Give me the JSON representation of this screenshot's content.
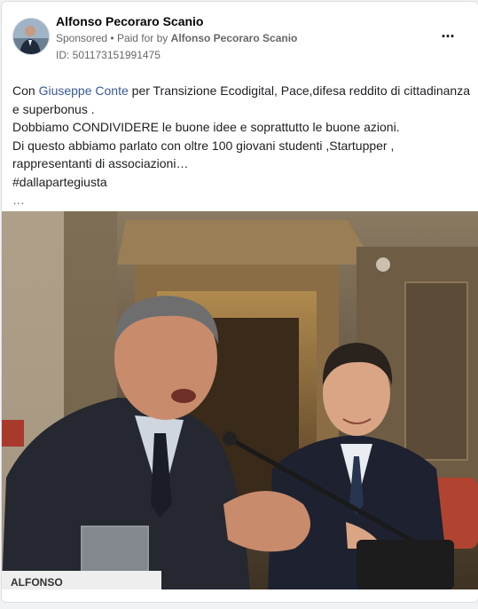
{
  "post": {
    "author": "Alfonso Pecoraro Scanio",
    "sponsored_label": "Sponsored",
    "separator": "•",
    "paid_for_prefix": "Paid for by",
    "paid_for_name": "Alfonso Pecoraro Scanio",
    "ad_id": "ID: 501173151991475",
    "more_icon": "more-horizontal-icon",
    "more_glyph": "···"
  },
  "text": {
    "line1_prefix": "Con ",
    "line1_mention": "Giuseppe Conte",
    "line1_suffix": " per Transizione Ecodigital, Pace,difesa reddito di cittadinanza",
    "line2": "e superbonus .",
    "line3": "Dobbiamo CONDIVIDERE le buone idee e soprattutto le buone azioni.",
    "line4": "Di questo abbiamo parlato con oltre 100 giovani studenti ,Startupper ,",
    "line5": "rappresentanti di associazioni…",
    "hashtag": "#dallapartegiusta",
    "see_more": "…"
  },
  "photo": {
    "nameplate_text": "ALFONSO"
  },
  "colors": {
    "link": "#385898",
    "secondary_text": "#65676b",
    "primary_text": "#050505"
  }
}
